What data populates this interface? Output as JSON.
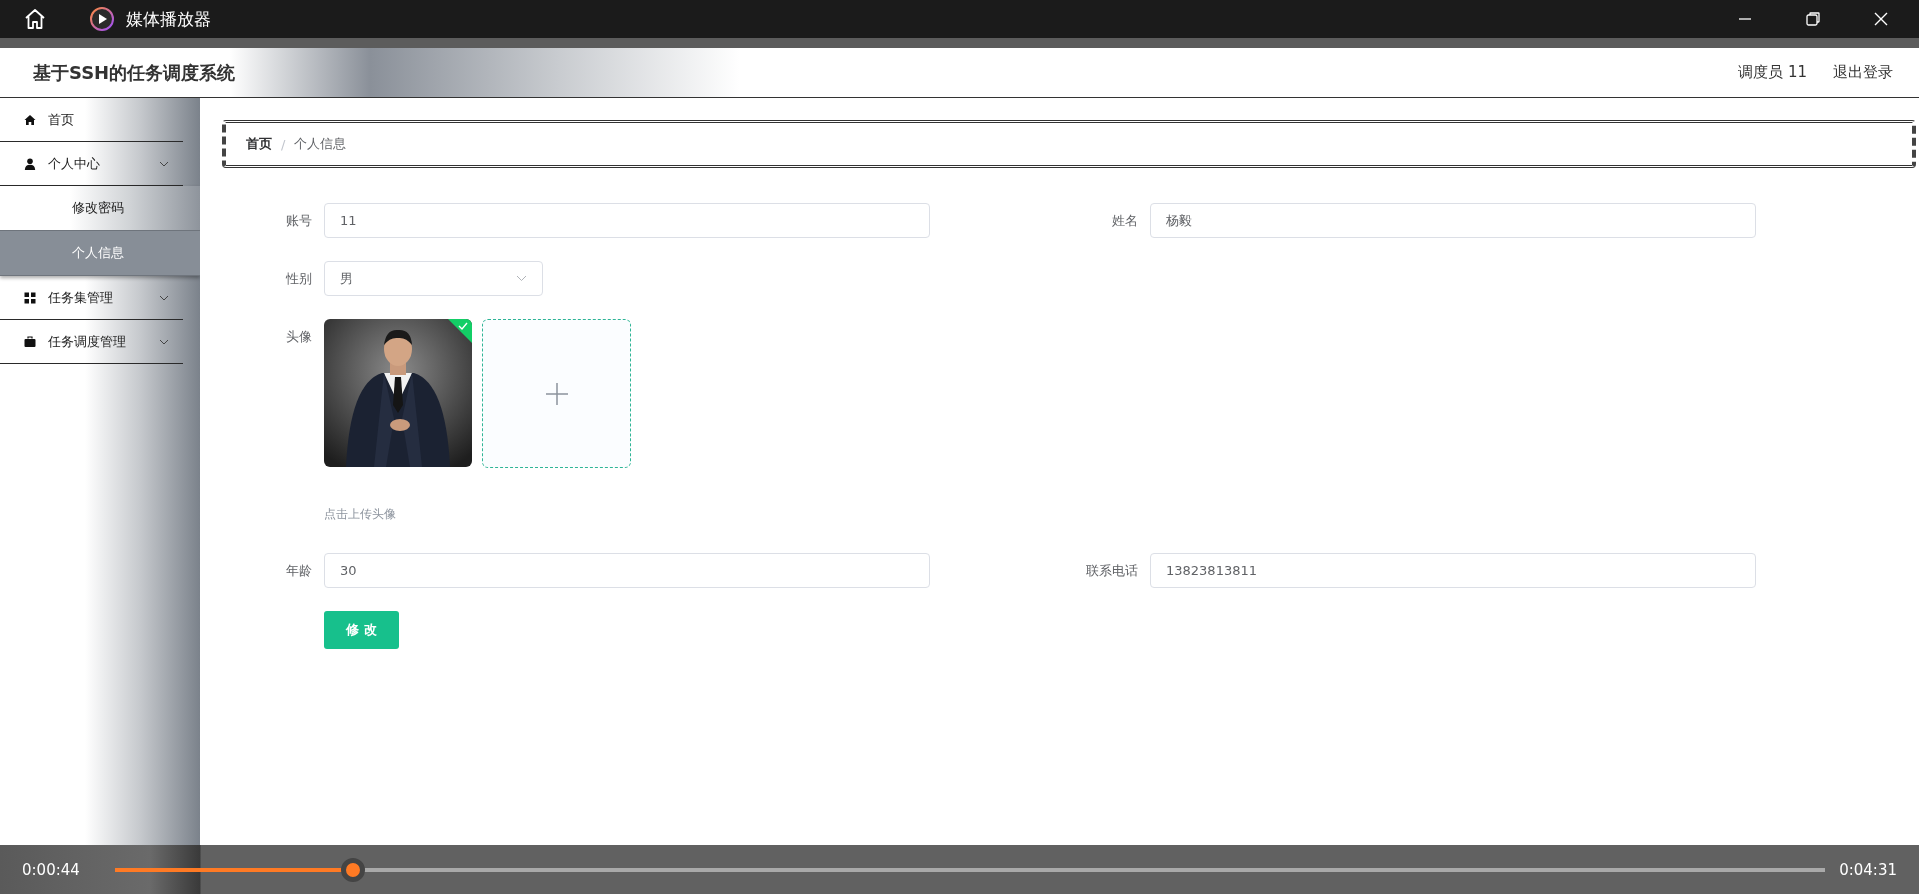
{
  "player": {
    "title": "媒体播放器",
    "elapsed": "0:00:44",
    "duration": "0:04:31",
    "level": 0.139
  },
  "app": {
    "title": "基于SSH的任务调度系统",
    "user": "调度员 11",
    "logout": "退出登录"
  },
  "sidebar": {
    "items": [
      {
        "label": "首页",
        "selected": false
      },
      {
        "label": "个人中心",
        "selected": false,
        "kind": "submenu",
        "expanded": true,
        "children": [
          {
            "label": "修改密码",
            "selected": false
          },
          {
            "label": "个人信息",
            "selected": true
          }
        ]
      },
      {
        "label": "任务集管理",
        "selected": false,
        "kind": "submenu"
      },
      {
        "label": "任务调度管理",
        "selected": false,
        "kind": "submenu"
      }
    ]
  },
  "breadcrumb": {
    "items": [
      "首页",
      "个人信息"
    ],
    "separator": "/"
  },
  "form": {
    "rows": [
      [
        {
          "label": "账号",
          "kind": "text",
          "value": "11"
        },
        {
          "label": "姓名",
          "kind": "text",
          "value": "杨毅"
        }
      ],
      [
        {
          "label": "性别",
          "kind": "select",
          "value": "男"
        }
      ],
      [
        {
          "label": "头像",
          "kind": "avatar",
          "uploaded": true,
          "hint": "点击上传头像"
        }
      ],
      [
        {
          "label": "年龄",
          "kind": "text",
          "value": "30"
        },
        {
          "label": "联系电话",
          "kind": "text",
          "value": "13823813811"
        }
      ]
    ],
    "submit": "修 改"
  }
}
